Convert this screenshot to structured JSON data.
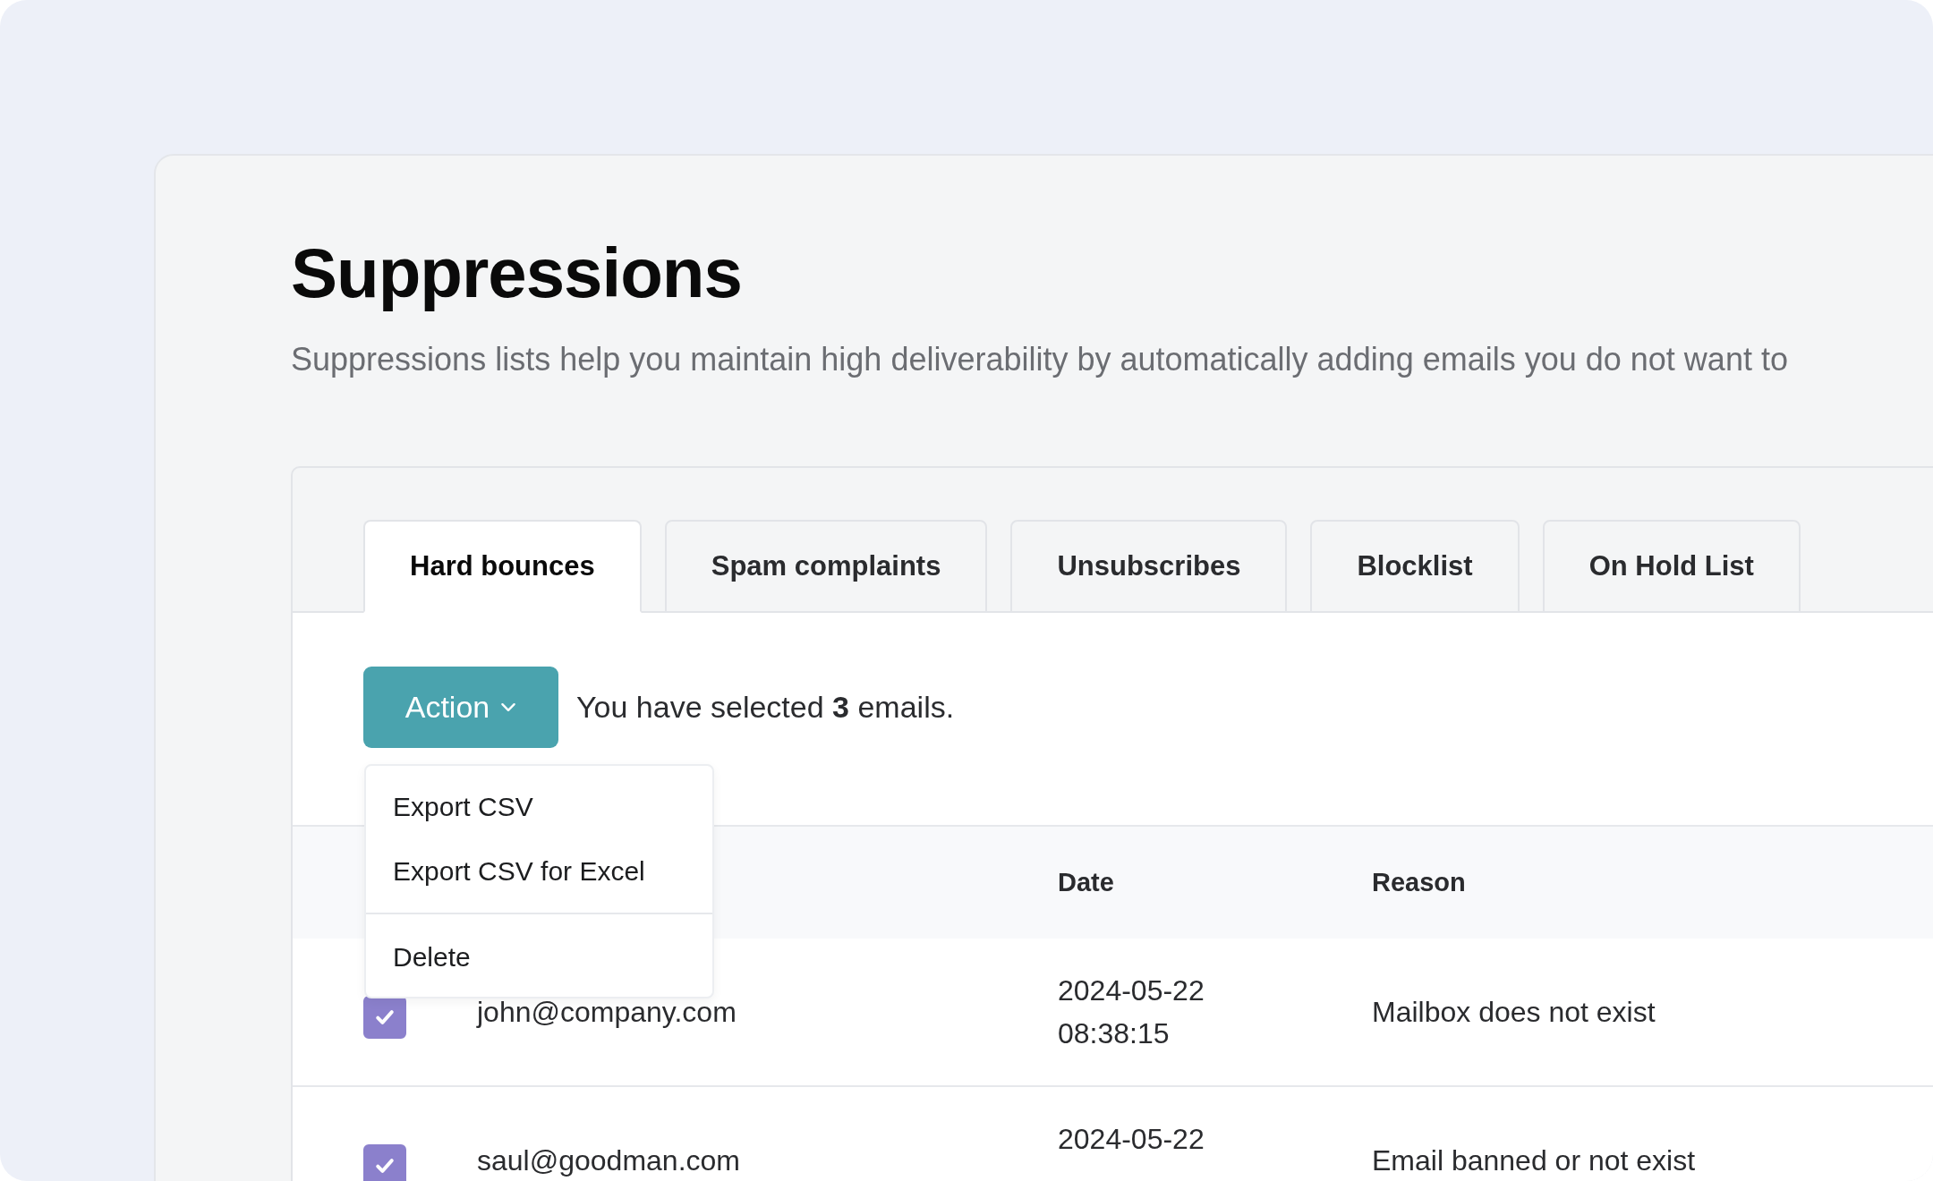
{
  "page": {
    "title": "Suppressions",
    "description": "Suppressions lists help you maintain high deliverability by automatically adding emails you do not want to"
  },
  "tabs": [
    {
      "label": "Hard bounces",
      "selected": true
    },
    {
      "label": "Spam complaints",
      "selected": false
    },
    {
      "label": "Unsubscribes",
      "selected": false
    },
    {
      "label": "Blocklist",
      "selected": false
    },
    {
      "label": "On Hold List",
      "selected": false
    }
  ],
  "action_button": {
    "label": "Action"
  },
  "selection_message": "You have selected **3** emails.",
  "action_menu": {
    "sections": [
      {
        "items": [
          "Export CSV",
          "Export CSV for Excel"
        ]
      },
      {
        "items": [
          "Delete"
        ]
      }
    ]
  },
  "table": {
    "columns": [
      "Date",
      "Reason"
    ],
    "rows": [
      {
        "checked": true,
        "email": "john@company.com",
        "date": "2024-05-22",
        "time": "08:38:15",
        "reason": "Mailbox does not exist"
      },
      {
        "checked": true,
        "email": "saul@goodman.com",
        "date": "2024-05-22",
        "reason": "Email banned or not exist"
      }
    ]
  }
}
